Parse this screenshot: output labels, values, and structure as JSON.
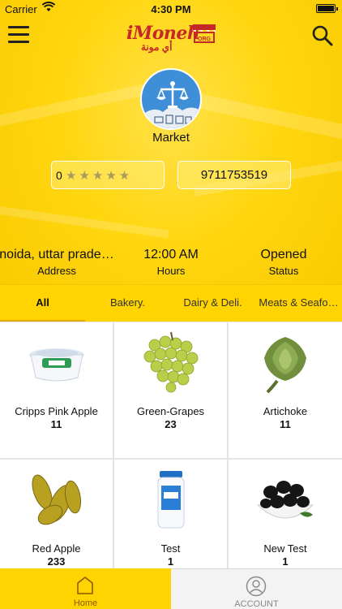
{
  "status_bar": {
    "carrier": "Carrier",
    "time": "4:30 PM",
    "battery_level": 1.0
  },
  "nav": {
    "logo_text": "iMoneh",
    "logo_arabic": "أي مونة",
    "menu_icon": "hamburger-icon",
    "search_icon": "search-icon"
  },
  "store": {
    "name": "Market",
    "avatar_icon": "scale-icon",
    "rating_value": "0",
    "rating_stars": 5,
    "phone": "9711753519",
    "address": "noida, uttar prade…",
    "address_label": "Address",
    "hours": "12:00 AM",
    "hours_label": "Hours",
    "status": "Opened",
    "status_label": "Status"
  },
  "tabs": [
    {
      "label": "All",
      "active": true
    },
    {
      "label": "Bakery.",
      "active": false
    },
    {
      "label": "Dairy & Deli.",
      "active": false
    },
    {
      "label": "Meats & Seafo…",
      "active": false
    }
  ],
  "products": [
    {
      "name": "Cripps Pink Apple",
      "qty": "11",
      "icon": "cheese-tub-icon"
    },
    {
      "name": "Green-Grapes",
      "qty": "23",
      "icon": "grapes-icon"
    },
    {
      "name": "Artichoke",
      "qty": "11",
      "icon": "artichoke-icon"
    },
    {
      "name": "Red Apple",
      "qty": "233",
      "icon": "pickles-icon"
    },
    {
      "name": "Test",
      "qty": "1",
      "icon": "jar-icon"
    },
    {
      "name": "New Test",
      "qty": "1",
      "icon": "olives-icon"
    }
  ],
  "bottom_tabs": [
    {
      "label": "Home",
      "icon": "home-icon",
      "active": true
    },
    {
      "label": "ACCOUNT",
      "icon": "account-icon",
      "active": false
    }
  ],
  "colors": {
    "primary": "#FFD400",
    "accent": "#C62828",
    "avatar_bg": "#3E8ED8"
  }
}
